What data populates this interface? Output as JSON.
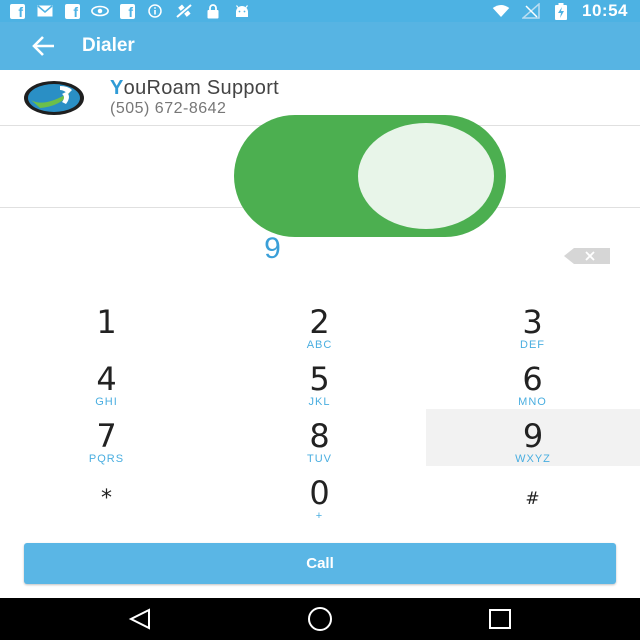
{
  "status_bar": {
    "time": "10:54",
    "left_icons": [
      "facebook-icon",
      "message-icon",
      "facebook-icon",
      "eye-icon",
      "facebook-icon",
      "info-icon",
      "satellite-icon",
      "lock-icon",
      "android-icon"
    ],
    "right_icons": [
      "wifi-icon",
      "signal-off-icon",
      "battery-charging-icon"
    ]
  },
  "app_bar": {
    "title": "Dialer"
  },
  "contact": {
    "name_first_letter": "Y",
    "name_rest": "ouRoam Support",
    "phone": "(505) 672-8642"
  },
  "toggle": {
    "state": "on",
    "color": "#4caf50"
  },
  "dialer": {
    "number": "9"
  },
  "keypad": [
    {
      "digit": "1",
      "letters": ""
    },
    {
      "digit": "2",
      "letters": "ABC"
    },
    {
      "digit": "3",
      "letters": "DEF"
    },
    {
      "digit": "4",
      "letters": "GHI"
    },
    {
      "digit": "5",
      "letters": "JKL"
    },
    {
      "digit": "6",
      "letters": "MNO"
    },
    {
      "digit": "7",
      "letters": "PQRS"
    },
    {
      "digit": "8",
      "letters": "TUV"
    },
    {
      "digit": "9",
      "letters": "WXYZ"
    },
    {
      "digit": "*",
      "letters": ""
    },
    {
      "digit": "0",
      "letters": "+"
    },
    {
      "digit": "#",
      "letters": ""
    }
  ],
  "call_button": {
    "label": "Call"
  },
  "colors": {
    "accent": "#57b4e3",
    "toggle_on": "#4caf50"
  }
}
